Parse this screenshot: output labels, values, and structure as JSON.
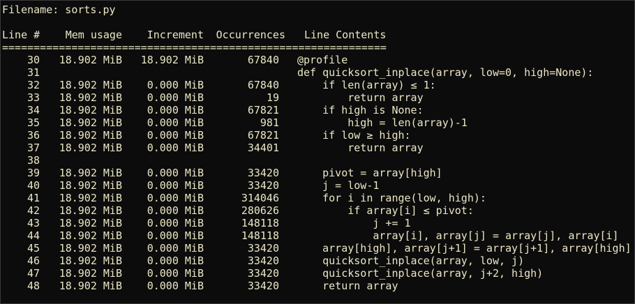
{
  "filename_line": "Filename: sorts.py",
  "headers": {
    "line_no": "Line #",
    "mem_usage": "Mem usage",
    "increment": "Increment",
    "occurrences": "Occurrences",
    "line_contents": "Line Contents"
  },
  "separator": "=============================================================",
  "rows": [
    {
      "line": "30",
      "mem": "18.902 MiB",
      "inc": "18.902 MiB",
      "occ": "67840",
      "code": "@profile"
    },
    {
      "line": "31",
      "mem": "",
      "inc": "",
      "occ": "",
      "code": "def quicksort_inplace(array, low=0, high=None):"
    },
    {
      "line": "32",
      "mem": "18.902 MiB",
      "inc": "0.000 MiB",
      "occ": "67840",
      "code": "    if len(array) ≤ 1:"
    },
    {
      "line": "33",
      "mem": "18.902 MiB",
      "inc": "0.000 MiB",
      "occ": "19",
      "code": "        return array"
    },
    {
      "line": "34",
      "mem": "18.902 MiB",
      "inc": "0.000 MiB",
      "occ": "67821",
      "code": "    if high is None:"
    },
    {
      "line": "35",
      "mem": "18.902 MiB",
      "inc": "0.000 MiB",
      "occ": "981",
      "code": "        high = len(array)-1"
    },
    {
      "line": "36",
      "mem": "18.902 MiB",
      "inc": "0.000 MiB",
      "occ": "67821",
      "code": "    if low ≥ high:"
    },
    {
      "line": "37",
      "mem": "18.902 MiB",
      "inc": "0.000 MiB",
      "occ": "34401",
      "code": "        return array"
    },
    {
      "line": "38",
      "mem": "",
      "inc": "",
      "occ": "",
      "code": ""
    },
    {
      "line": "39",
      "mem": "18.902 MiB",
      "inc": "0.000 MiB",
      "occ": "33420",
      "code": "    pivot = array[high]"
    },
    {
      "line": "40",
      "mem": "18.902 MiB",
      "inc": "0.000 MiB",
      "occ": "33420",
      "code": "    j = low-1"
    },
    {
      "line": "41",
      "mem": "18.902 MiB",
      "inc": "0.000 MiB",
      "occ": "314046",
      "code": "    for i in range(low, high):"
    },
    {
      "line": "42",
      "mem": "18.902 MiB",
      "inc": "0.000 MiB",
      "occ": "280626",
      "code": "        if array[i] ≤ pivot:"
    },
    {
      "line": "43",
      "mem": "18.902 MiB",
      "inc": "0.000 MiB",
      "occ": "148118",
      "code": "            j += 1"
    },
    {
      "line": "44",
      "mem": "18.902 MiB",
      "inc": "0.000 MiB",
      "occ": "148118",
      "code": "            array[i], array[j] = array[j], array[i]"
    },
    {
      "line": "45",
      "mem": "18.902 MiB",
      "inc": "0.000 MiB",
      "occ": "33420",
      "code": "    array[high], array[j+1] = array[j+1], array[high]"
    },
    {
      "line": "46",
      "mem": "18.902 MiB",
      "inc": "0.000 MiB",
      "occ": "33420",
      "code": "    quicksort_inplace(array, low, j)"
    },
    {
      "line": "47",
      "mem": "18.902 MiB",
      "inc": "0.000 MiB",
      "occ": "33420",
      "code": "    quicksort_inplace(array, j+2, high)"
    },
    {
      "line": "48",
      "mem": "18.902 MiB",
      "inc": "0.000 MiB",
      "occ": "33420",
      "code": "    return array"
    }
  ],
  "colors": {
    "background": "#0c0c0c",
    "foreground": "#ece7c6"
  }
}
